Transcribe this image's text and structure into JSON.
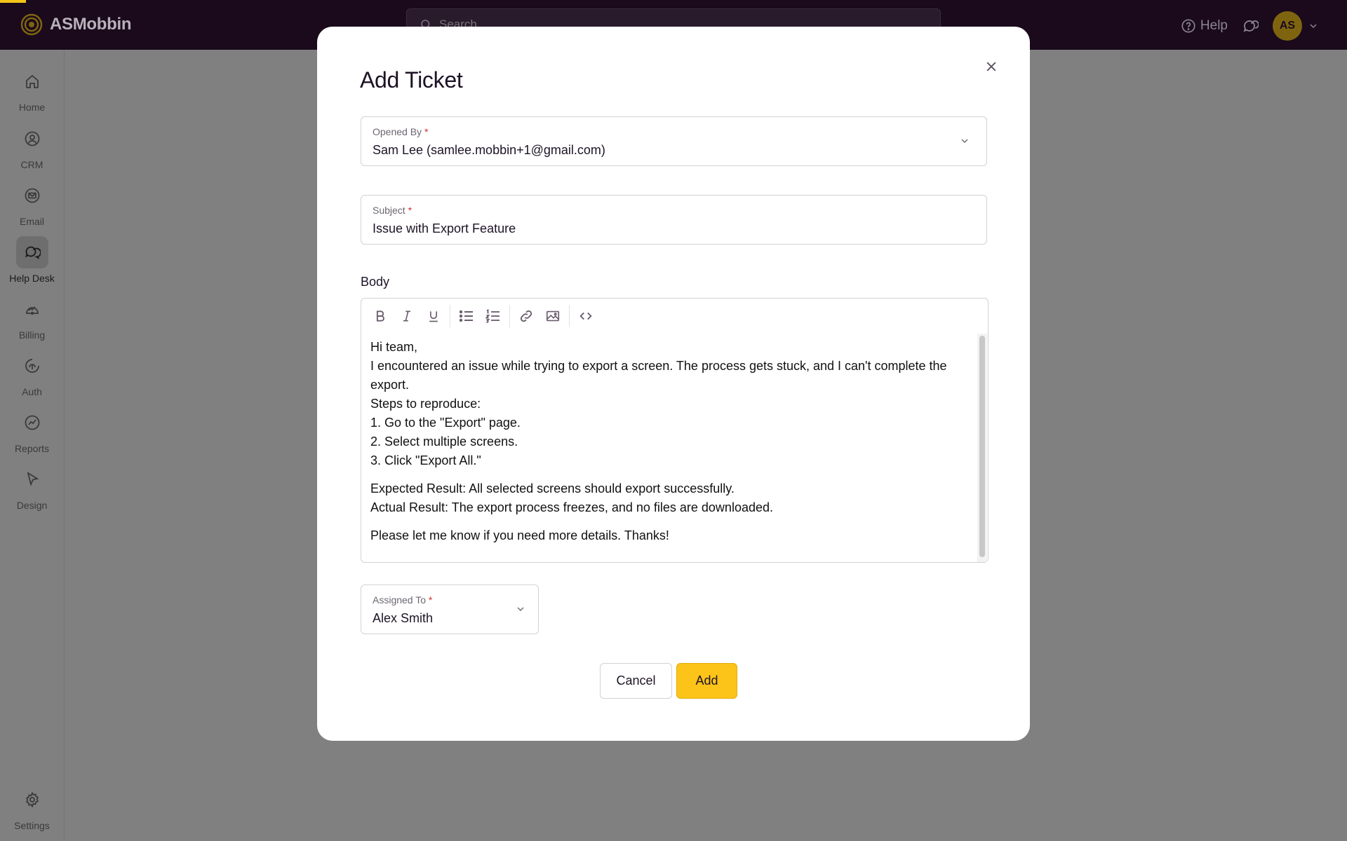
{
  "topbar": {
    "brand_name": "ASMobbin",
    "search_placeholder": "Search",
    "help_label": "Help",
    "avatar_initials": "AS"
  },
  "sidebar": {
    "items": [
      {
        "label": "Home",
        "icon": "home-icon"
      },
      {
        "label": "CRM",
        "icon": "crm-icon"
      },
      {
        "label": "Email",
        "icon": "email-icon"
      },
      {
        "label": "Help Desk",
        "icon": "help-desk-icon",
        "active": true
      },
      {
        "label": "Billing",
        "icon": "billing-icon"
      },
      {
        "label": "Auth",
        "icon": "auth-icon"
      },
      {
        "label": "Reports",
        "icon": "reports-icon"
      },
      {
        "label": "Design",
        "icon": "design-icon"
      }
    ],
    "settings_label": "Settings"
  },
  "modal": {
    "title": "Add Ticket",
    "opened_by": {
      "label": "Opened By",
      "required_mark": "*",
      "value": "Sam Lee (samlee.mobbin+1@gmail.com)"
    },
    "subject": {
      "label": "Subject",
      "required_mark": "*",
      "value": "Issue with Export Feature"
    },
    "body_label": "Body",
    "body": {
      "lines_1": [
        "Hi team,",
        "I encountered an issue while trying to export a screen. The process gets stuck, and I can't complete the export.",
        "Steps to reproduce:",
        "1. Go to the \"Export\" page.",
        "2. Select multiple screens.",
        "3. Click \"Export All.\""
      ],
      "lines_2": [
        "Expected Result: All selected screens should export successfully.",
        "Actual Result: The export process freezes, and no files are downloaded."
      ],
      "lines_3": [
        "Please let me know if you need more details. Thanks!"
      ]
    },
    "assigned_to": {
      "label": "Assigned To",
      "required_mark": "*",
      "value": "Alex Smith"
    },
    "cancel_label": "Cancel",
    "add_label": "Add"
  },
  "colors": {
    "topbar_bg": "#1a0a1c",
    "accent": "#fcc419",
    "overlay": "#808080",
    "required": "#d32f2f"
  }
}
